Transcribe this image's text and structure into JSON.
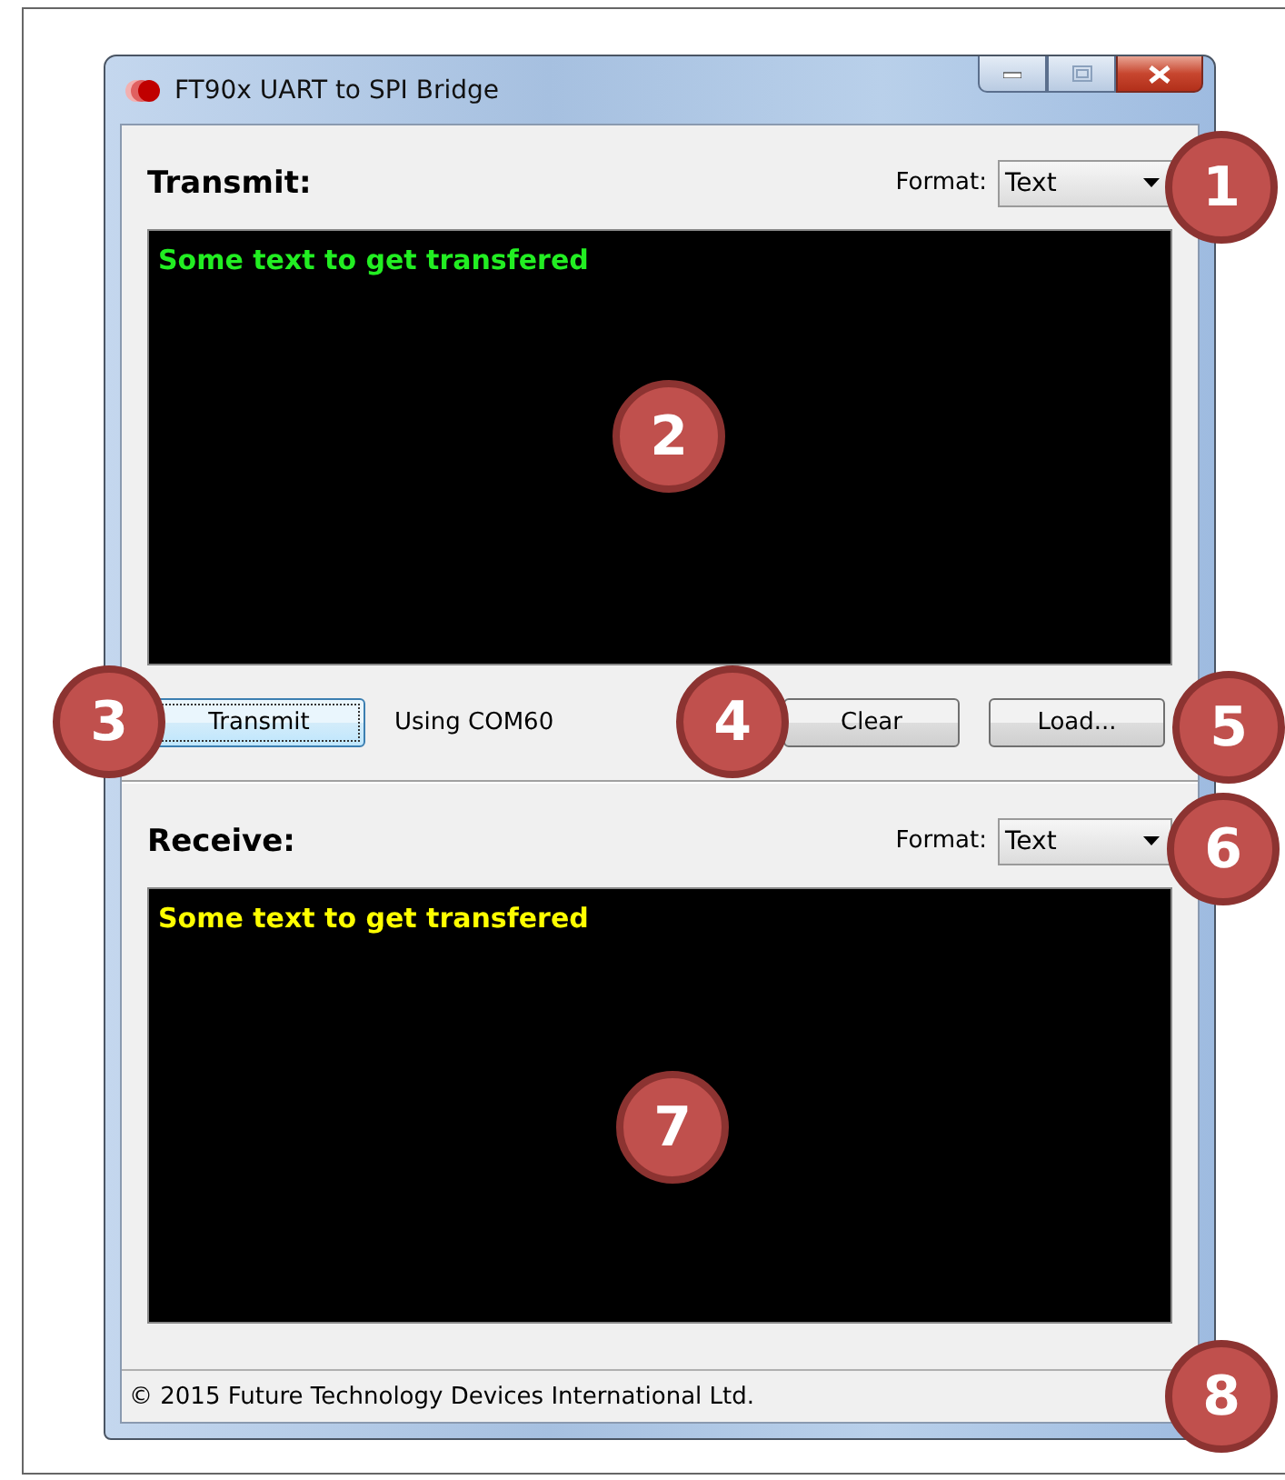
{
  "window": {
    "title": "FT90x UART to SPI Bridge"
  },
  "sections": [
    {
      "heading": "Transmit:",
      "format_label": "Format:",
      "format_value": "Text",
      "content": "Some text to get transfered",
      "color": "#22ee22"
    },
    {
      "heading": "Receive:",
      "format_label": "Format:",
      "format_value": "Text",
      "content": "Some text to get transfered",
      "color": "#ffff00"
    }
  ],
  "toolbar": {
    "buttons": [
      {
        "label": "Transmit",
        "focused": true
      },
      {
        "label": "Clear",
        "focused": false
      },
      {
        "label": "Load...",
        "focused": false
      }
    ],
    "port": "Using COM60"
  },
  "status_bar": "© 2015 Future Technology Devices International Ltd.",
  "callouts": [
    "1",
    "2",
    "3",
    "4",
    "5",
    "6",
    "7",
    "8"
  ]
}
